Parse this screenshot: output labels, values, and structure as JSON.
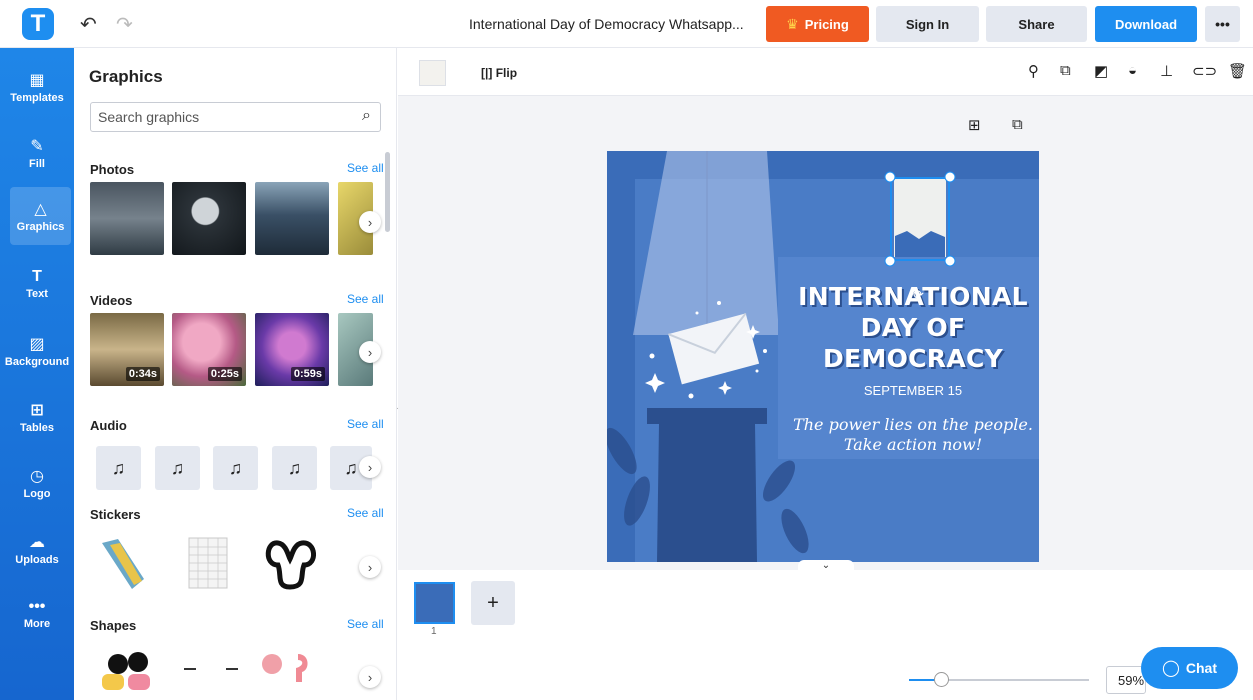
{
  "app": {
    "logo_letter": "T",
    "brand_color": "#1e8ef0",
    "accent_color": "#f05a22"
  },
  "header": {
    "doc_title": "International Day of Democracy Whatsapp...",
    "pricing": "Pricing",
    "sign_in": "Sign In",
    "share": "Share",
    "download": "Download",
    "more": "•••"
  },
  "rail": {
    "items": [
      {
        "label": "Templates",
        "icon": "templates-icon"
      },
      {
        "label": "Fill",
        "icon": "pencil-icon"
      },
      {
        "label": "Graphics",
        "icon": "shapes-icon"
      },
      {
        "label": "Text",
        "icon": "text-icon"
      },
      {
        "label": "Background",
        "icon": "background-icon"
      },
      {
        "label": "Tables",
        "icon": "table-icon"
      },
      {
        "label": "Logo",
        "icon": "logo-icon"
      },
      {
        "label": "Uploads",
        "icon": "cloud-upload-icon"
      },
      {
        "label": "More",
        "icon": "more-icon"
      }
    ]
  },
  "panel": {
    "title": "Graphics",
    "search_placeholder": "Search graphics",
    "sections": {
      "photos": {
        "title": "Photos",
        "see_all": "See all"
      },
      "videos": {
        "title": "Videos",
        "see_all": "See all",
        "durations": [
          "0:34s",
          "0:25s",
          "0:59s"
        ]
      },
      "audio": {
        "title": "Audio",
        "see_all": "See all"
      },
      "stickers": {
        "title": "Stickers",
        "see_all": "See all"
      },
      "shapes": {
        "title": "Shapes",
        "see_all": "See all"
      }
    }
  },
  "toolbar": {
    "flip": "Flip"
  },
  "canvas": {
    "headline": "INTERNATIONAL DAY OF DEMOCRACY",
    "date": "SEPTEMBER 15",
    "slogan_line1": "The power lies on the people.",
    "slogan_line2": "Take action now!"
  },
  "pages": {
    "current": "1",
    "add": "+"
  },
  "zoom": {
    "value": "59%",
    "level_fraction": 0.18
  },
  "chat": {
    "label": "Chat"
  }
}
